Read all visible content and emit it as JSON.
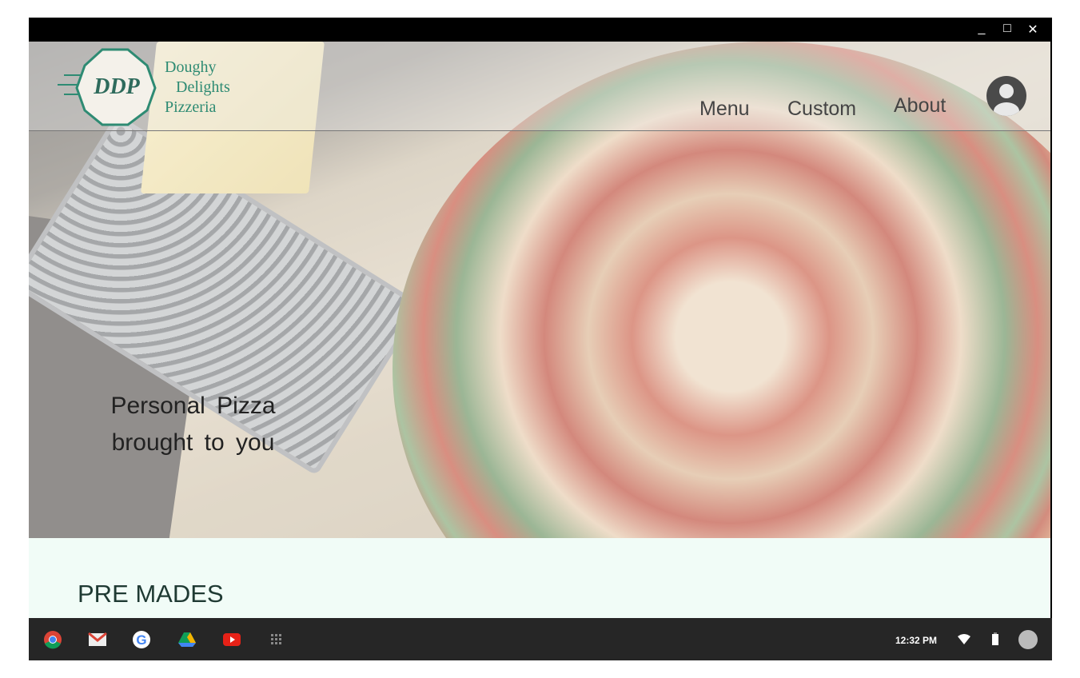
{
  "window": {
    "minimize": "_",
    "maximize": "□",
    "close": "✕"
  },
  "brand": {
    "abbr": "DDP",
    "line1": "Doughy",
    "line2": "Delights",
    "line3": "Pizzeria",
    "color": "#2e8b73"
  },
  "nav": {
    "menu": "Menu",
    "custom": "Custom",
    "about": "About"
  },
  "hero": {
    "line1": "Personal  Pizza",
    "line2": "brought  to you"
  },
  "section": {
    "title": "PRE MADES"
  },
  "shelf": {
    "apps": [
      "chrome-icon",
      "gmail-icon",
      "google-icon",
      "drive-icon",
      "youtube-icon",
      "launcher-icon"
    ],
    "time": "12:32 PM"
  }
}
